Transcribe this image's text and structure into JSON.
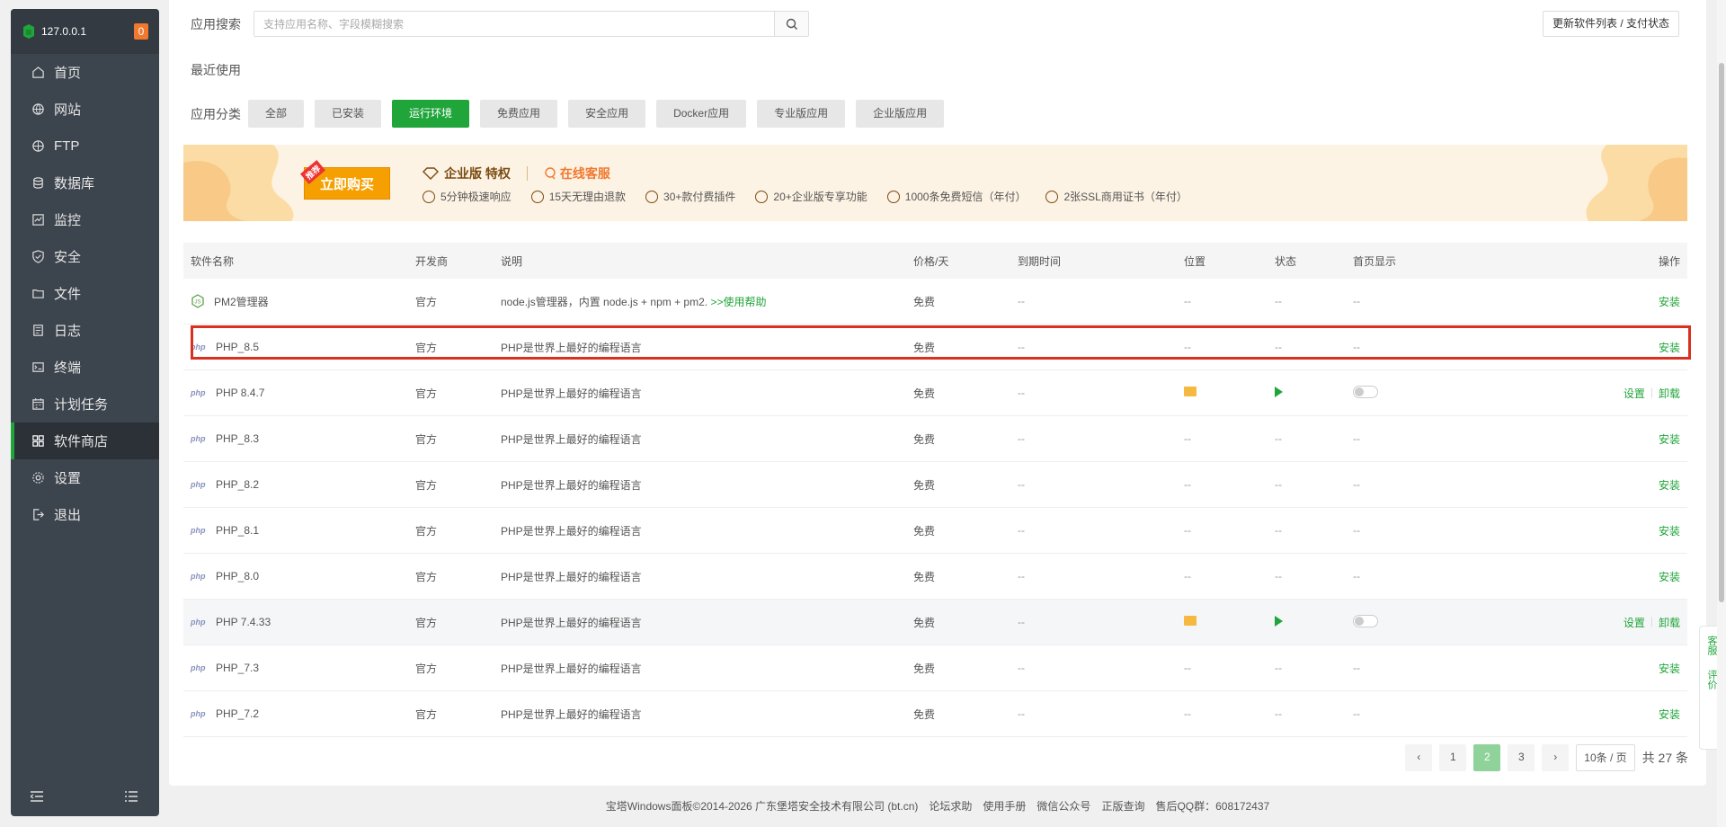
{
  "sidebar": {
    "ip": "127.0.0.1",
    "badge": "0",
    "items": [
      {
        "label": "首页",
        "icon": "home-icon"
      },
      {
        "label": "网站",
        "icon": "globe-icon"
      },
      {
        "label": "FTP",
        "icon": "ftp-icon"
      },
      {
        "label": "数据库",
        "icon": "database-icon"
      },
      {
        "label": "监控",
        "icon": "monitor-icon"
      },
      {
        "label": "安全",
        "icon": "shield-icon"
      },
      {
        "label": "文件",
        "icon": "folder-icon"
      },
      {
        "label": "日志",
        "icon": "log-icon"
      },
      {
        "label": "终端",
        "icon": "terminal-icon"
      },
      {
        "label": "计划任务",
        "icon": "calendar-icon"
      },
      {
        "label": "软件商店",
        "icon": "apps-icon"
      },
      {
        "label": "设置",
        "icon": "gear-icon"
      },
      {
        "label": "退出",
        "icon": "logout-icon"
      }
    ],
    "active_index": 10
  },
  "search": {
    "label": "应用搜索",
    "placeholder": "支持应用名称、字段模糊搜索"
  },
  "update_button": "更新软件列表 / 支付状态",
  "recent_label": "最近使用",
  "categories": {
    "label": "应用分类",
    "items": [
      "全部",
      "已安装",
      "运行环境",
      "免费应用",
      "安全应用",
      "Docker应用",
      "专业版应用",
      "企业版应用"
    ],
    "active_index": 2
  },
  "banner": {
    "buy_label": "立即购买",
    "hot_tag": "推荐",
    "enterprise_title": "企业版 特权",
    "service_label": "在线客服",
    "features": [
      "5分钟极速响应",
      "15天无理由退款",
      "30+款付费插件",
      "20+企业版专享功能",
      "1000条免费短信（年付）",
      "2张SSL商用证书（年付）"
    ]
  },
  "table": {
    "headers": {
      "name": "软件名称",
      "dev": "开发商",
      "desc": "说明",
      "price": "价格/天",
      "expire": "到期时间",
      "location": "位置",
      "status": "状态",
      "home": "首页显示",
      "ops": "操作"
    },
    "rows": [
      {
        "name": "PM2管理器",
        "icon": "nodejs-icon",
        "dev": "官方",
        "desc": "node.js管理器，内置 node.js + npm + pm2.",
        "help": ">>使用帮助",
        "price": "免费",
        "expire": "--",
        "location": "--",
        "status": "--",
        "home": "--",
        "installed": false,
        "install": "安装"
      },
      {
        "name": "PHP_8.5",
        "icon": "php-icon",
        "dev": "官方",
        "desc": "PHP是世界上最好的编程语言",
        "price": "免费",
        "expire": "--",
        "location": "--",
        "status": "--",
        "home": "--",
        "installed": false,
        "install": "安装"
      },
      {
        "name": "PHP 8.4.7",
        "icon": "php-icon",
        "dev": "官方",
        "desc": "PHP是世界上最好的编程语言",
        "price": "免费",
        "expire": "--",
        "installed": true,
        "settings": "设置",
        "uninstall": "卸载"
      },
      {
        "name": "PHP_8.3",
        "icon": "php-icon",
        "dev": "官方",
        "desc": "PHP是世界上最好的编程语言",
        "price": "免费",
        "expire": "--",
        "location": "--",
        "status": "--",
        "home": "--",
        "installed": false,
        "install": "安装"
      },
      {
        "name": "PHP_8.2",
        "icon": "php-icon",
        "dev": "官方",
        "desc": "PHP是世界上最好的编程语言",
        "price": "免费",
        "expire": "--",
        "location": "--",
        "status": "--",
        "home": "--",
        "installed": false,
        "install": "安装"
      },
      {
        "name": "PHP_8.1",
        "icon": "php-icon",
        "dev": "官方",
        "desc": "PHP是世界上最好的编程语言",
        "price": "免费",
        "expire": "--",
        "location": "--",
        "status": "--",
        "home": "--",
        "installed": false,
        "install": "安装"
      },
      {
        "name": "PHP_8.0",
        "icon": "php-icon",
        "dev": "官方",
        "desc": "PHP是世界上最好的编程语言",
        "price": "免费",
        "expire": "--",
        "location": "--",
        "status": "--",
        "home": "--",
        "installed": false,
        "install": "安装"
      },
      {
        "name": "PHP 7.4.33",
        "icon": "php-icon",
        "dev": "官方",
        "desc": "PHP是世界上最好的编程语言",
        "price": "免费",
        "expire": "--",
        "installed": true,
        "settings": "设置",
        "uninstall": "卸载"
      },
      {
        "name": "PHP_7.3",
        "icon": "php-icon",
        "dev": "官方",
        "desc": "PHP是世界上最好的编程语言",
        "price": "免费",
        "expire": "--",
        "location": "--",
        "status": "--",
        "home": "--",
        "installed": false,
        "install": "安装"
      },
      {
        "name": "PHP_7.2",
        "icon": "php-icon",
        "dev": "官方",
        "desc": "PHP是世界上最好的编程语言",
        "price": "免费",
        "expire": "--",
        "location": "--",
        "status": "--",
        "home": "--",
        "installed": false,
        "install": "安装"
      }
    ]
  },
  "pagination": {
    "pages": [
      "1",
      "2",
      "3"
    ],
    "current": "2",
    "page_size": "10条 / 页",
    "total": "共 27 条"
  },
  "footer": {
    "copyright": "宝塔Windows面板©2014-2026 广东堡塔安全技术有限公司 (bt.cn)",
    "links": [
      "论坛求助",
      "使用手册",
      "微信公众号",
      "正版查询",
      "售后QQ群：608172437"
    ]
  },
  "float": {
    "service": "客服",
    "review": "评价"
  },
  "colors": {
    "accent": "#20a53a",
    "sidebar_bg": "#3c444d",
    "highlight_border": "#d9301f",
    "banner_bg": "#fdf3e4"
  }
}
